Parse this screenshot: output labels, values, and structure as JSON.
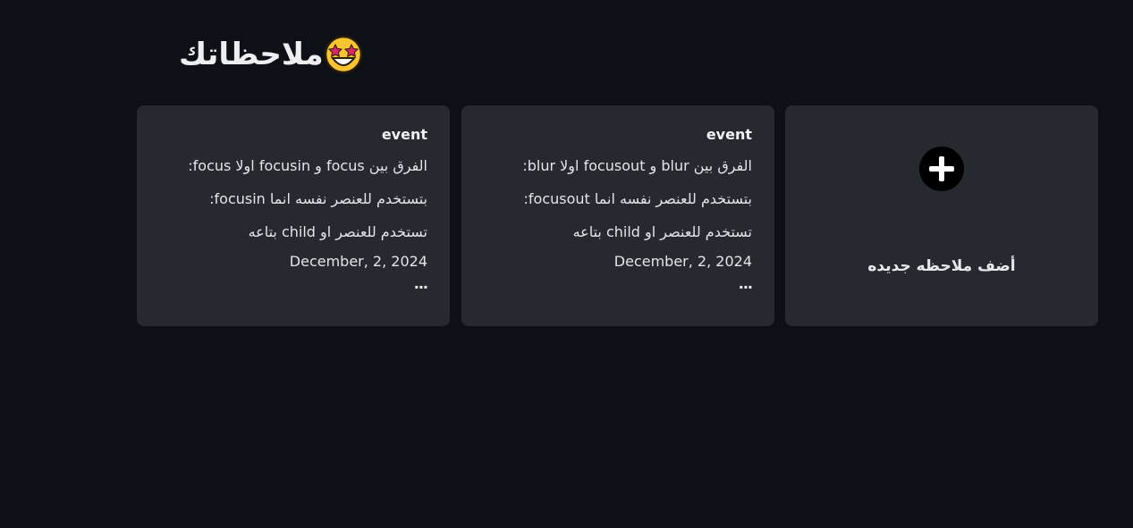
{
  "header": {
    "title": "ملاحظاتك",
    "emoji_icon": "star-struck-emoji-icon"
  },
  "add_card": {
    "label": "أضف ملاحظه جديده",
    "icon": "plus-circle-icon"
  },
  "notes": [
    {
      "title": "event",
      "lines": [
        "الفرق بين blur و focusout اولا blur:",
        "بتستخدم للعنصر نفسه انما focusout:",
        "تستخدم للعنصر او child بتاعه"
      ],
      "date": "December, 2, 2024",
      "more": "..."
    },
    {
      "title": "event",
      "lines": [
        "الفرق بين focus و focusin اولا focus:",
        "بتستخدم للعنصر نفسه انما focusin:",
        "تستخدم للعنصر او child بتاعه"
      ],
      "date": "December, 2, 2024",
      "more": "..."
    }
  ],
  "colors": {
    "background": "#0d1017",
    "card": "#262a30",
    "text": "#e6e7ea"
  }
}
